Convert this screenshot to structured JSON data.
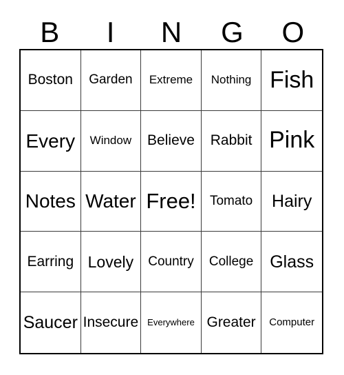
{
  "card": {
    "title": "Bingo Card",
    "background_color": "#ffffff",
    "text_color": "#000000",
    "border_color": "#000000",
    "gridline_color": "#3a3a3a"
  },
  "header": {
    "letters": [
      "B",
      "I",
      "N",
      "G",
      "O"
    ]
  },
  "grid": {
    "columns": 5,
    "rows": 5,
    "free_space": "Free!",
    "free_space_position": {
      "row": 3,
      "column": 3
    },
    "rows_data": [
      [
        {
          "label": "Boston",
          "size": "fs-ml"
        },
        {
          "label": "Garden",
          "size": "fs-m"
        },
        {
          "label": "Extreme",
          "size": "fs-sm"
        },
        {
          "label": "Nothing",
          "size": "fs-sm"
        },
        {
          "label": "Fish",
          "size": "fs-mega"
        }
      ],
      [
        {
          "label": "Every",
          "size": "fs-xxl"
        },
        {
          "label": "Window",
          "size": "fs-sm"
        },
        {
          "label": "Believe",
          "size": "fs-ml"
        },
        {
          "label": "Rabbit",
          "size": "fs-ml"
        },
        {
          "label": "Pink",
          "size": "fs-mega"
        }
      ],
      [
        {
          "label": "Notes",
          "size": "fs-xxl"
        },
        {
          "label": "Water",
          "size": "fs-xxl"
        },
        {
          "label": "Free!",
          "size": "fs-huge"
        },
        {
          "label": "Tomato",
          "size": "fs-m"
        },
        {
          "label": "Hairy",
          "size": "fs-xl"
        }
      ],
      [
        {
          "label": "Earring",
          "size": "fs-ml"
        },
        {
          "label": "Lovely",
          "size": "fs-l"
        },
        {
          "label": "Country",
          "size": "fs-m"
        },
        {
          "label": "College",
          "size": "fs-m"
        },
        {
          "label": "Glass",
          "size": "fs-xl"
        }
      ],
      [
        {
          "label": "Saucer",
          "size": "fs-xl"
        },
        {
          "label": "Insecure",
          "size": "fs-ml"
        },
        {
          "label": "Everywhere",
          "size": "fs-xs"
        },
        {
          "label": "Greater",
          "size": "fs-ml"
        },
        {
          "label": "Computer",
          "size": "fs-s"
        }
      ]
    ]
  }
}
